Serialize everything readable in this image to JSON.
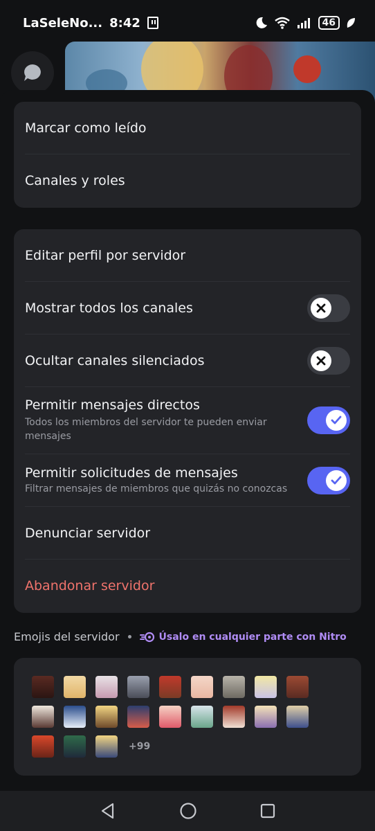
{
  "status_bar": {
    "carrier": "LaSeleNo...",
    "time": "8:42",
    "battery": "46"
  },
  "menu_group_1": {
    "items": [
      {
        "label": "Marcar como leído"
      },
      {
        "label": "Canales y roles"
      }
    ]
  },
  "menu_group_2": {
    "items": [
      {
        "label": "Editar perfil por servidor"
      },
      {
        "label": "Mostrar todos los canales",
        "toggle": "off"
      },
      {
        "label": "Ocultar canales silenciados",
        "toggle": "off"
      },
      {
        "label": "Permitir mensajes directos",
        "sub": "Todos los miembros del servidor te pueden enviar mensajes",
        "toggle": "on"
      },
      {
        "label": "Permitir solicitudes de mensajes",
        "sub": "Filtrar mensajes de miembros que quizás no conozcas",
        "toggle": "on"
      },
      {
        "label": "Denunciar servidor"
      },
      {
        "label": "Abandonar servidor",
        "danger": true
      }
    ]
  },
  "emojis_section": {
    "title": "Emojis del servidor",
    "nitro_text": "Úsalo en cualquier parte con Nitro",
    "more_count": "+99"
  },
  "colors": {
    "accent": "#5865f2",
    "danger": "#f0736c",
    "nitro": "#b08cf5"
  }
}
